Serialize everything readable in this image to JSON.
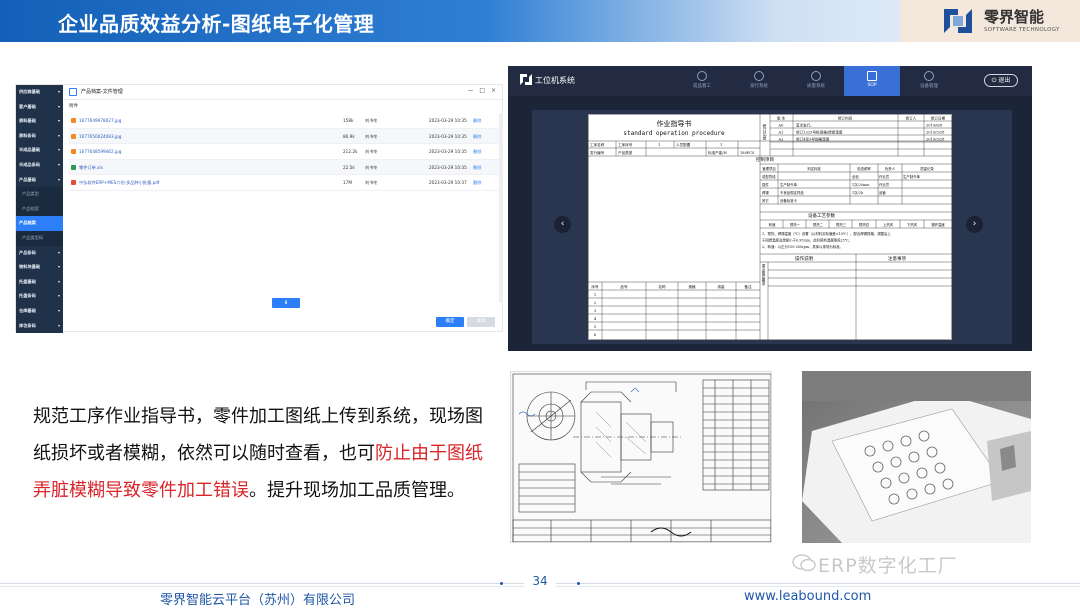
{
  "header": {
    "title": "企业品质效益分析-图纸电子化管理",
    "brand_name": "零界智能",
    "brand_sub": "SOFTWARE TECHNOLOGY"
  },
  "file_manager": {
    "window_title": "产品档案-文件管理",
    "window_controls": "— □ ×",
    "section_label": "附件",
    "sidebar": [
      {
        "label": "供应商基础",
        "type": "group"
      },
      {
        "label": "客户基础",
        "type": "group"
      },
      {
        "label": "原料基础",
        "type": "group"
      },
      {
        "label": "原料条码",
        "type": "group"
      },
      {
        "label": "半成品基础",
        "type": "group"
      },
      {
        "label": "半成品条码",
        "type": "group"
      },
      {
        "label": "产品基础",
        "type": "group"
      },
      {
        "label": "产品类型",
        "type": "sub"
      },
      {
        "label": "产品档案",
        "type": "sub"
      },
      {
        "label": "产品档案",
        "type": "active"
      },
      {
        "label": "产品类型码",
        "type": "sub"
      },
      {
        "label": "产品条码",
        "type": "group"
      },
      {
        "label": "物料块基础",
        "type": "group"
      },
      {
        "label": "托盘基础",
        "type": "group"
      },
      {
        "label": "托盘条码",
        "type": "group"
      },
      {
        "label": "仓库基础",
        "type": "group"
      },
      {
        "label": "库位条码",
        "type": "group"
      }
    ],
    "files": [
      {
        "name": "1677649978027.jpg",
        "size": "158k",
        "user": "刘书冬",
        "date": "2023-03-29 10:35",
        "action": "删除",
        "color": "#f08a24"
      },
      {
        "name": "1677650024083.jpg",
        "size": "86.9k",
        "user": "刘书冬",
        "date": "2023-03-29 10:35",
        "action": "删除",
        "color": "#f08a24"
      },
      {
        "name": "1677648599462.jpg",
        "size": "212.2k",
        "user": "刘书冬",
        "date": "2023-03-29 10:35",
        "action": "删除",
        "color": "#f08a24"
      },
      {
        "name": "零件订单.xls",
        "size": "22.5k",
        "user": "刘书冬",
        "date": "2023-03-29 10:35",
        "action": "删除",
        "color": "#2e9c4f"
      },
      {
        "name": "中弘软件ERP+MES介绍-多品种小批量.pdf",
        "size": "17M",
        "user": "刘书冬",
        "date": "2023-03-29 10:37",
        "action": "删除",
        "color": "#e64a3b"
      }
    ],
    "download_glyph": "⬇",
    "confirm_label": "确定",
    "cancel_label": "关闭"
  },
  "workstation": {
    "app_name": "工位机系统",
    "tabs": [
      {
        "label": "成品看工",
        "active": false
      },
      {
        "label": "发行系统",
        "active": false
      },
      {
        "label": "质量系统",
        "active": false
      },
      {
        "label": "SOP",
        "active": true
      },
      {
        "label": "设备管理",
        "active": false
      }
    ],
    "exit_label": "退出",
    "prev_glyph": "‹",
    "next_glyph": "›",
    "sop": {
      "title": "作业指导书",
      "title_en": "standard operation procedure",
      "rev_header": [
        "版 本",
        "修订内容",
        "修订人",
        "修订日期"
      ],
      "revisions": [
        [
          "A0",
          "首次发行。",
          "2019/6/8"
        ],
        [
          "A1",
          "修订1/2/3号机规格/焊接温度",
          "2019/3/28"
        ],
        [
          "A2",
          "修订4至9号规格温度",
          "2019/3/28"
        ]
      ],
      "rev_side": "修订记录",
      "info": [
        "工序名称",
        "工序序号",
        "1",
        "人员配置",
        "1",
        "发行编号",
        "产品类型",
        "标准产能/H",
        "180PCS"
      ],
      "control_title": "控制项目",
      "control_cols": [
        "管理项目",
        "判定标准",
        "检查频率",
        "负责人",
        "质量记录"
      ],
      "control_rows": [
        "成型导线",
        "插件",
        "焊锡",
        "其它"
      ],
      "control_vals": [
        "全检",
        "作业员",
        "生产制令单",
        "1次/20min",
        "作业员",
        "1次/2h",
        "品管"
      ],
      "control_texts": [
        "生产制令单",
        "不良品规定样品 ",
        "设备标准卡"
      ],
      "equip_title": "设备工艺参数",
      "equip_cols": [
        "转速",
        "预热一",
        "预热二",
        "预热三",
        "预热四",
        "上热风",
        "下热风",
        "锡炉温度"
      ],
      "notes": [
        "1、预热、焊锡温度（℃）设置（以材料实际偏差±10℃）。配合焊锡规格，调整后上",
        "于回焊温度及焊接小于6.95mm，此时预热温度降低25℃。",
        "2、转速：以正为150-260rpm，具体以现场为标准。"
      ],
      "op_title": "操作说明",
      "caution_title": "注意事项",
      "parts_cols": [
        "序号",
        "品号",
        "名称",
        "规格",
        "用量",
        "备注"
      ],
      "parts_rows": [
        "1",
        "2",
        "3",
        "4",
        "5",
        "6"
      ],
      "side_label": "重点管控要求"
    }
  },
  "paragraph": {
    "part1": "规范工序作业指导书，零件加工图纸上传到系统，现场图纸损坏或者模糊，依然可以随时查看，也可",
    "highlight": "防止由于图纸弄脏模糊导致零件加工错误",
    "part2": "。提升现场加工品质管理。"
  },
  "watermark": "ERP数字化工厂",
  "footer": {
    "page_number": "34",
    "company": "零界智能云平台（苏州）有限公司",
    "url": "www.leabound.com"
  }
}
